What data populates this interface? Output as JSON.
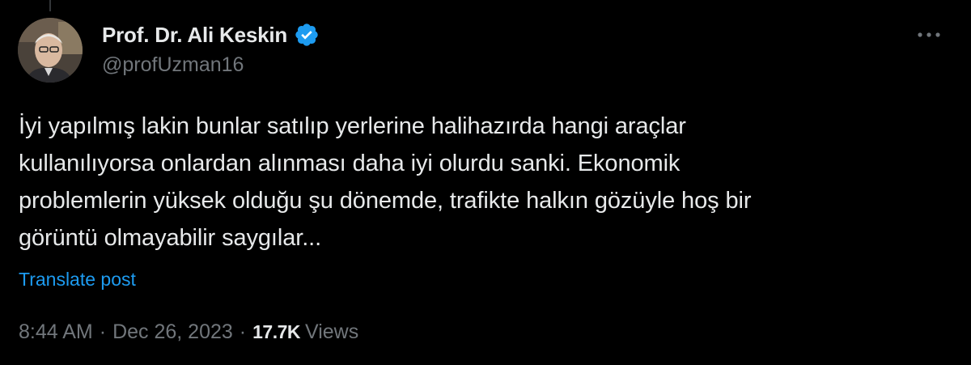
{
  "author": {
    "display_name": "Prof. Dr. Ali Keskin",
    "handle": "@profUzman16",
    "verified_icon": "verified-badge-icon",
    "verified_color": "#1d9bf0"
  },
  "more_icon": "more-horizontal-icon",
  "tweet": {
    "lines": [
      "İyi yapılmış lakin bunlar satılıp yerlerine halihazırda hangi araçlar",
      "kullanılıyorsa onlardan alınması daha iyi olurdu sanki. Ekonomik",
      "problemlerin yüksek olduğu şu dönemde, trafikte halkın gözüyle hoş bir",
      "görüntü olmayabilir saygılar..."
    ],
    "translate_label": "Translate post"
  },
  "meta": {
    "time": "8:44 AM",
    "separator": "·",
    "date": "Dec 26, 2023",
    "views_count": "17.7K",
    "views_label": "Views"
  },
  "colors": {
    "background": "#000000",
    "text_primary": "#e7e9ea",
    "text_secondary": "#71767b",
    "accent": "#1d9bf0"
  }
}
